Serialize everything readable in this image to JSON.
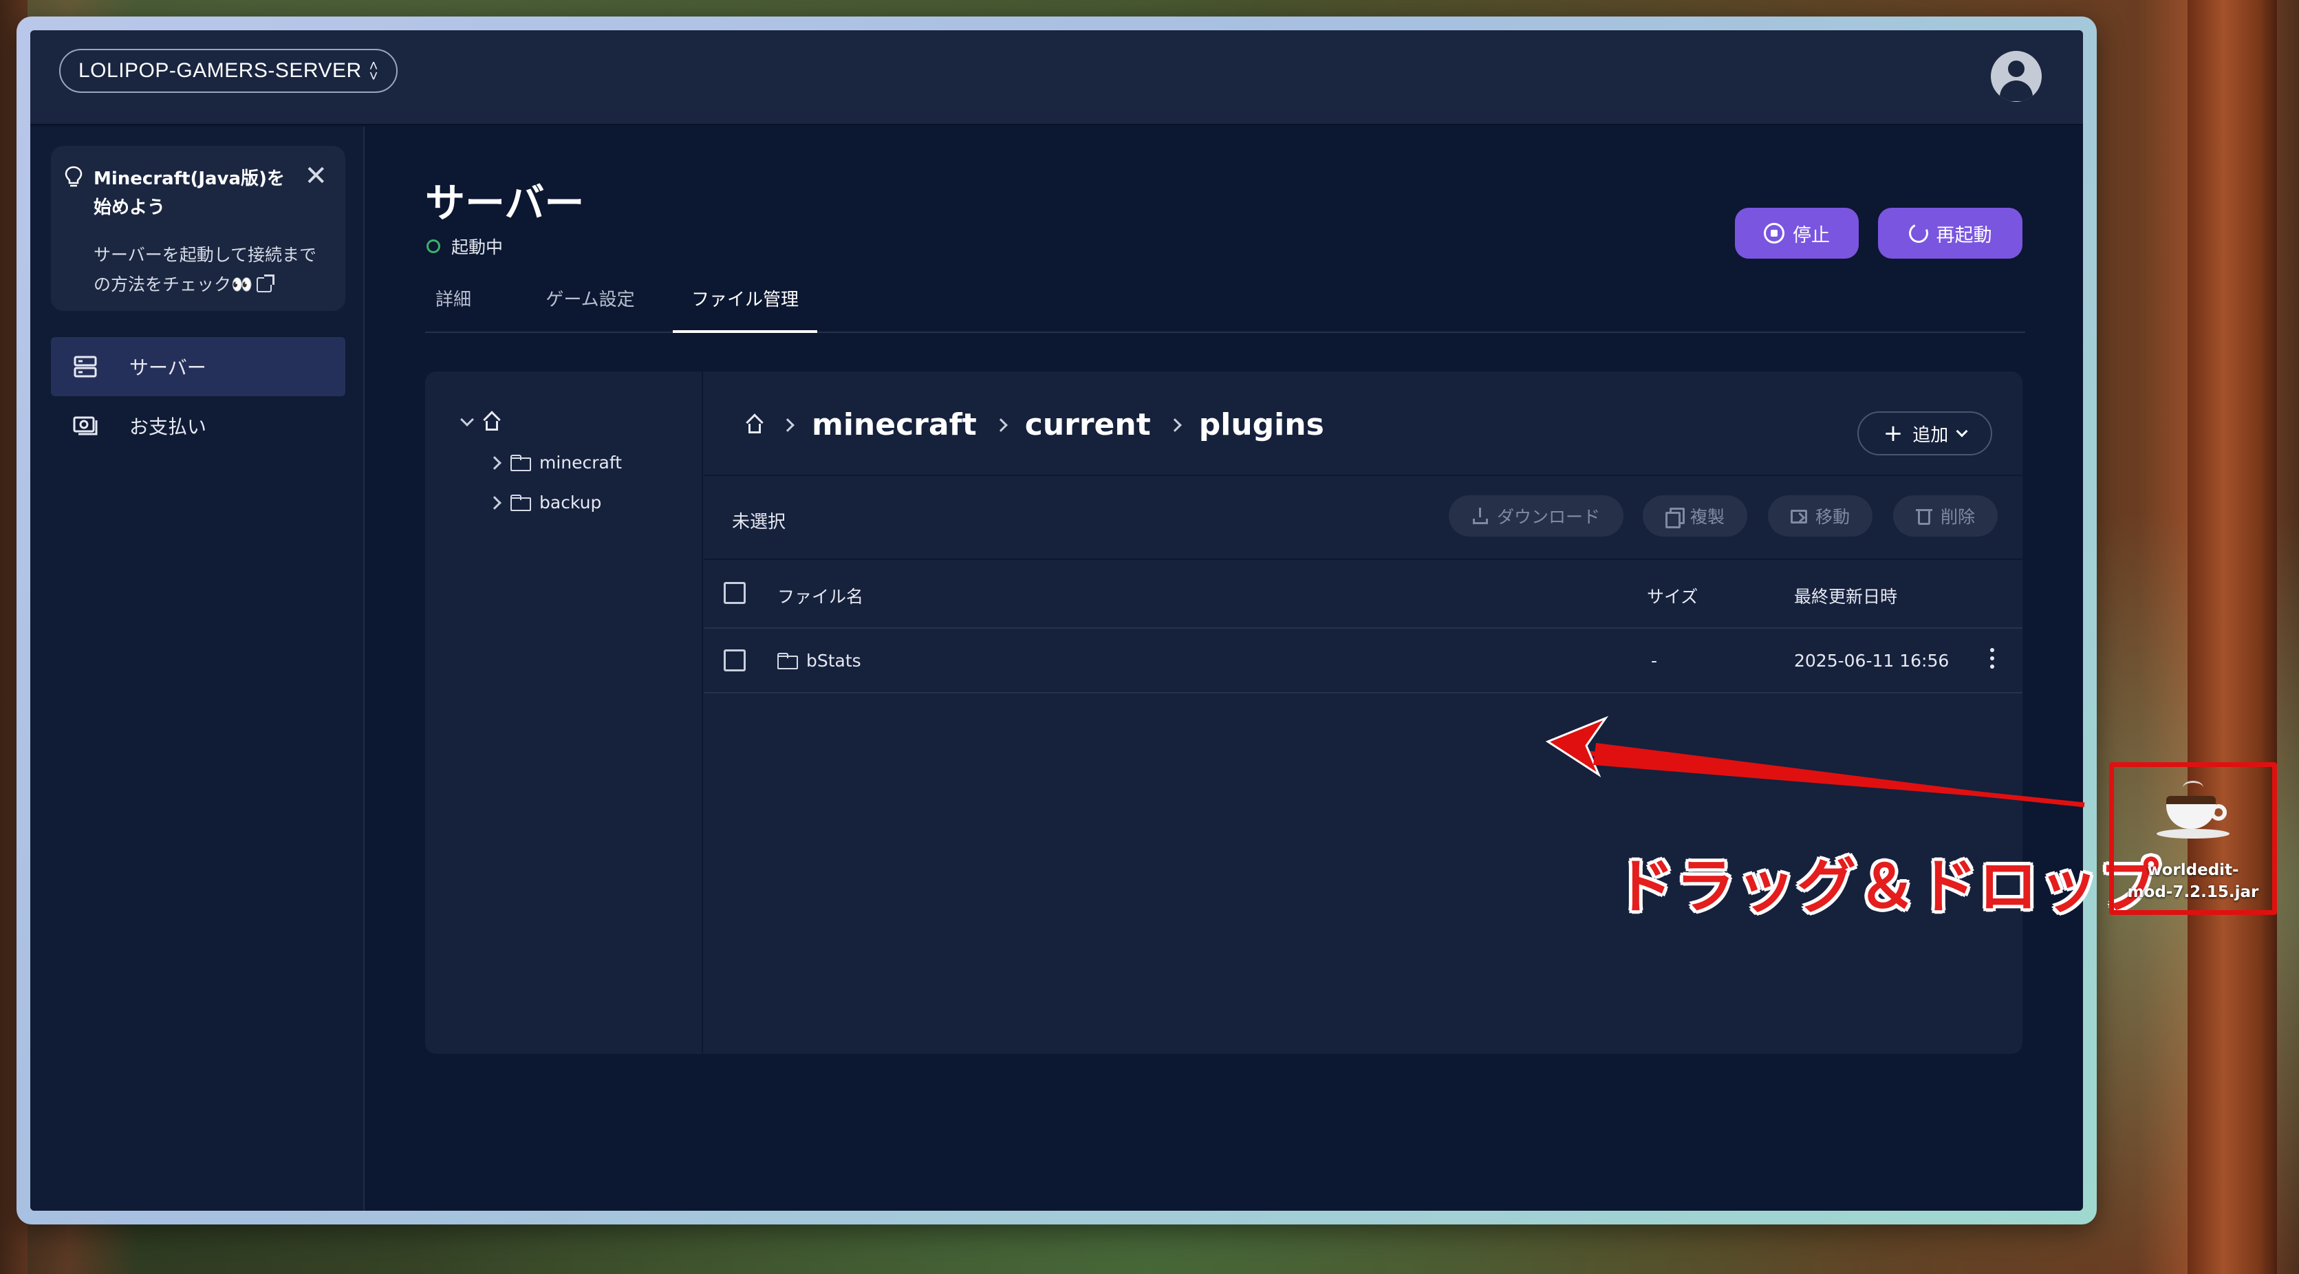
{
  "topbar": {
    "server_name": "LOLIPOP-GAMERS-SERVER",
    "server_select_icon": "chevron-up-down-icon",
    "account_icon": "user-avatar-icon"
  },
  "sidebar": {
    "tip": {
      "title": "Minecraft(Java版)を始めよう",
      "body": "サーバーを起動して接続までの方法をチェック👀",
      "icon": "lightbulb-icon",
      "close_icon": "close-icon",
      "link_icon": "external-link-icon"
    },
    "items": [
      {
        "label": "サーバー",
        "icon": "server-icon",
        "active": true
      },
      {
        "label": "お支払い",
        "icon": "payment-icon",
        "active": false
      }
    ]
  },
  "main": {
    "title": "サーバー",
    "status": "起動中",
    "status_color": "#3fae6a",
    "buttons": {
      "stop": "停止",
      "restart": "再起動",
      "accent": "#7a55e0"
    },
    "tabs": [
      {
        "label": "詳細",
        "active": false
      },
      {
        "label": "ゲーム設定",
        "active": false
      },
      {
        "label": "ファイル管理",
        "active": true
      }
    ]
  },
  "file_manager": {
    "tree": {
      "root_icon": "home-icon",
      "folders": [
        "minecraft",
        "backup"
      ]
    },
    "breadcrumb": [
      "minecraft",
      "current",
      "plugins"
    ],
    "add_button": "追加",
    "selection": "未選択",
    "actions": {
      "download": "ダウンロード",
      "duplicate": "複製",
      "move": "移動",
      "delete": "削除"
    },
    "columns": {
      "name": "ファイル名",
      "size": "サイズ",
      "modified": "最終更新日時"
    },
    "rows": [
      {
        "name": "bStats",
        "size": "-",
        "modified": "2025-06-11 16:56",
        "type": "folder"
      }
    ]
  },
  "desktop": {
    "file_label_line1": "worldedit-",
    "file_label_line2": "mod-7.2.15.jar",
    "file_icon": "java-coffee-cup-icon",
    "annotation": "ドラッグ＆ドロップ",
    "annotation_color": "#e41d1d"
  }
}
